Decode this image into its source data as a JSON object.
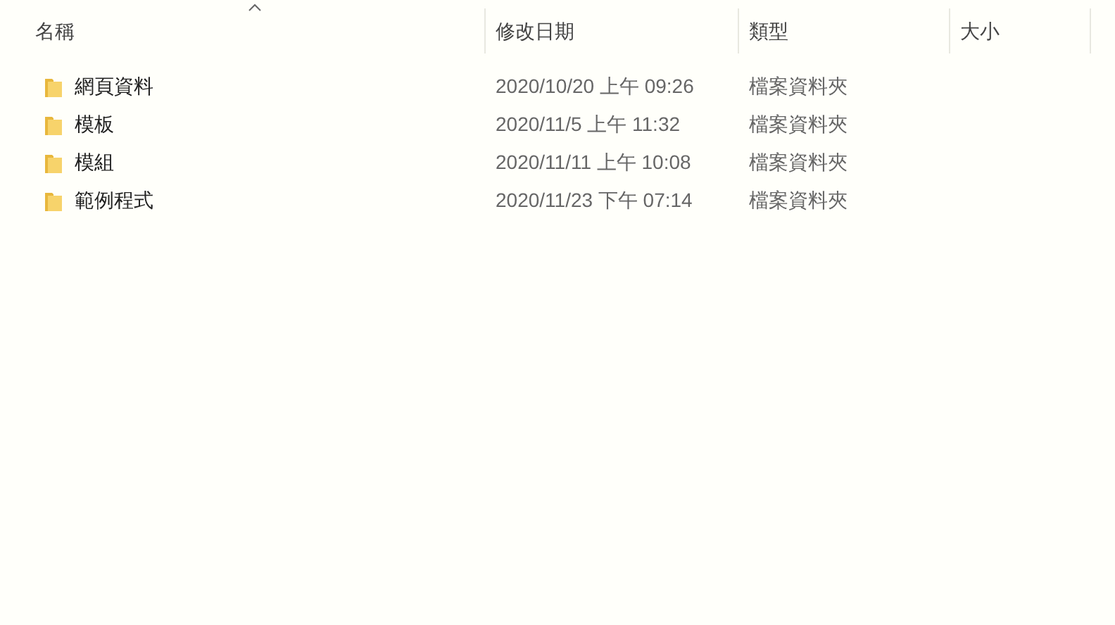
{
  "columns": [
    {
      "label": "名稱",
      "sorted": true
    },
    {
      "label": "修改日期",
      "sorted": false
    },
    {
      "label": "類型",
      "sorted": false
    },
    {
      "label": "大小",
      "sorted": false
    }
  ],
  "rows": [
    {
      "name": "網頁資料",
      "modified": "2020/10/20 上午 09:26",
      "type": "檔案資料夾"
    },
    {
      "name": "模板",
      "modified": "2020/11/5 上午 11:32",
      "type": "檔案資料夾"
    },
    {
      "name": "模組",
      "modified": "2020/11/11 上午 10:08",
      "type": "檔案資料夾"
    },
    {
      "name": "範例程式",
      "modified": "2020/11/23 下午 07:14",
      "type": "檔案資料夾"
    }
  ]
}
